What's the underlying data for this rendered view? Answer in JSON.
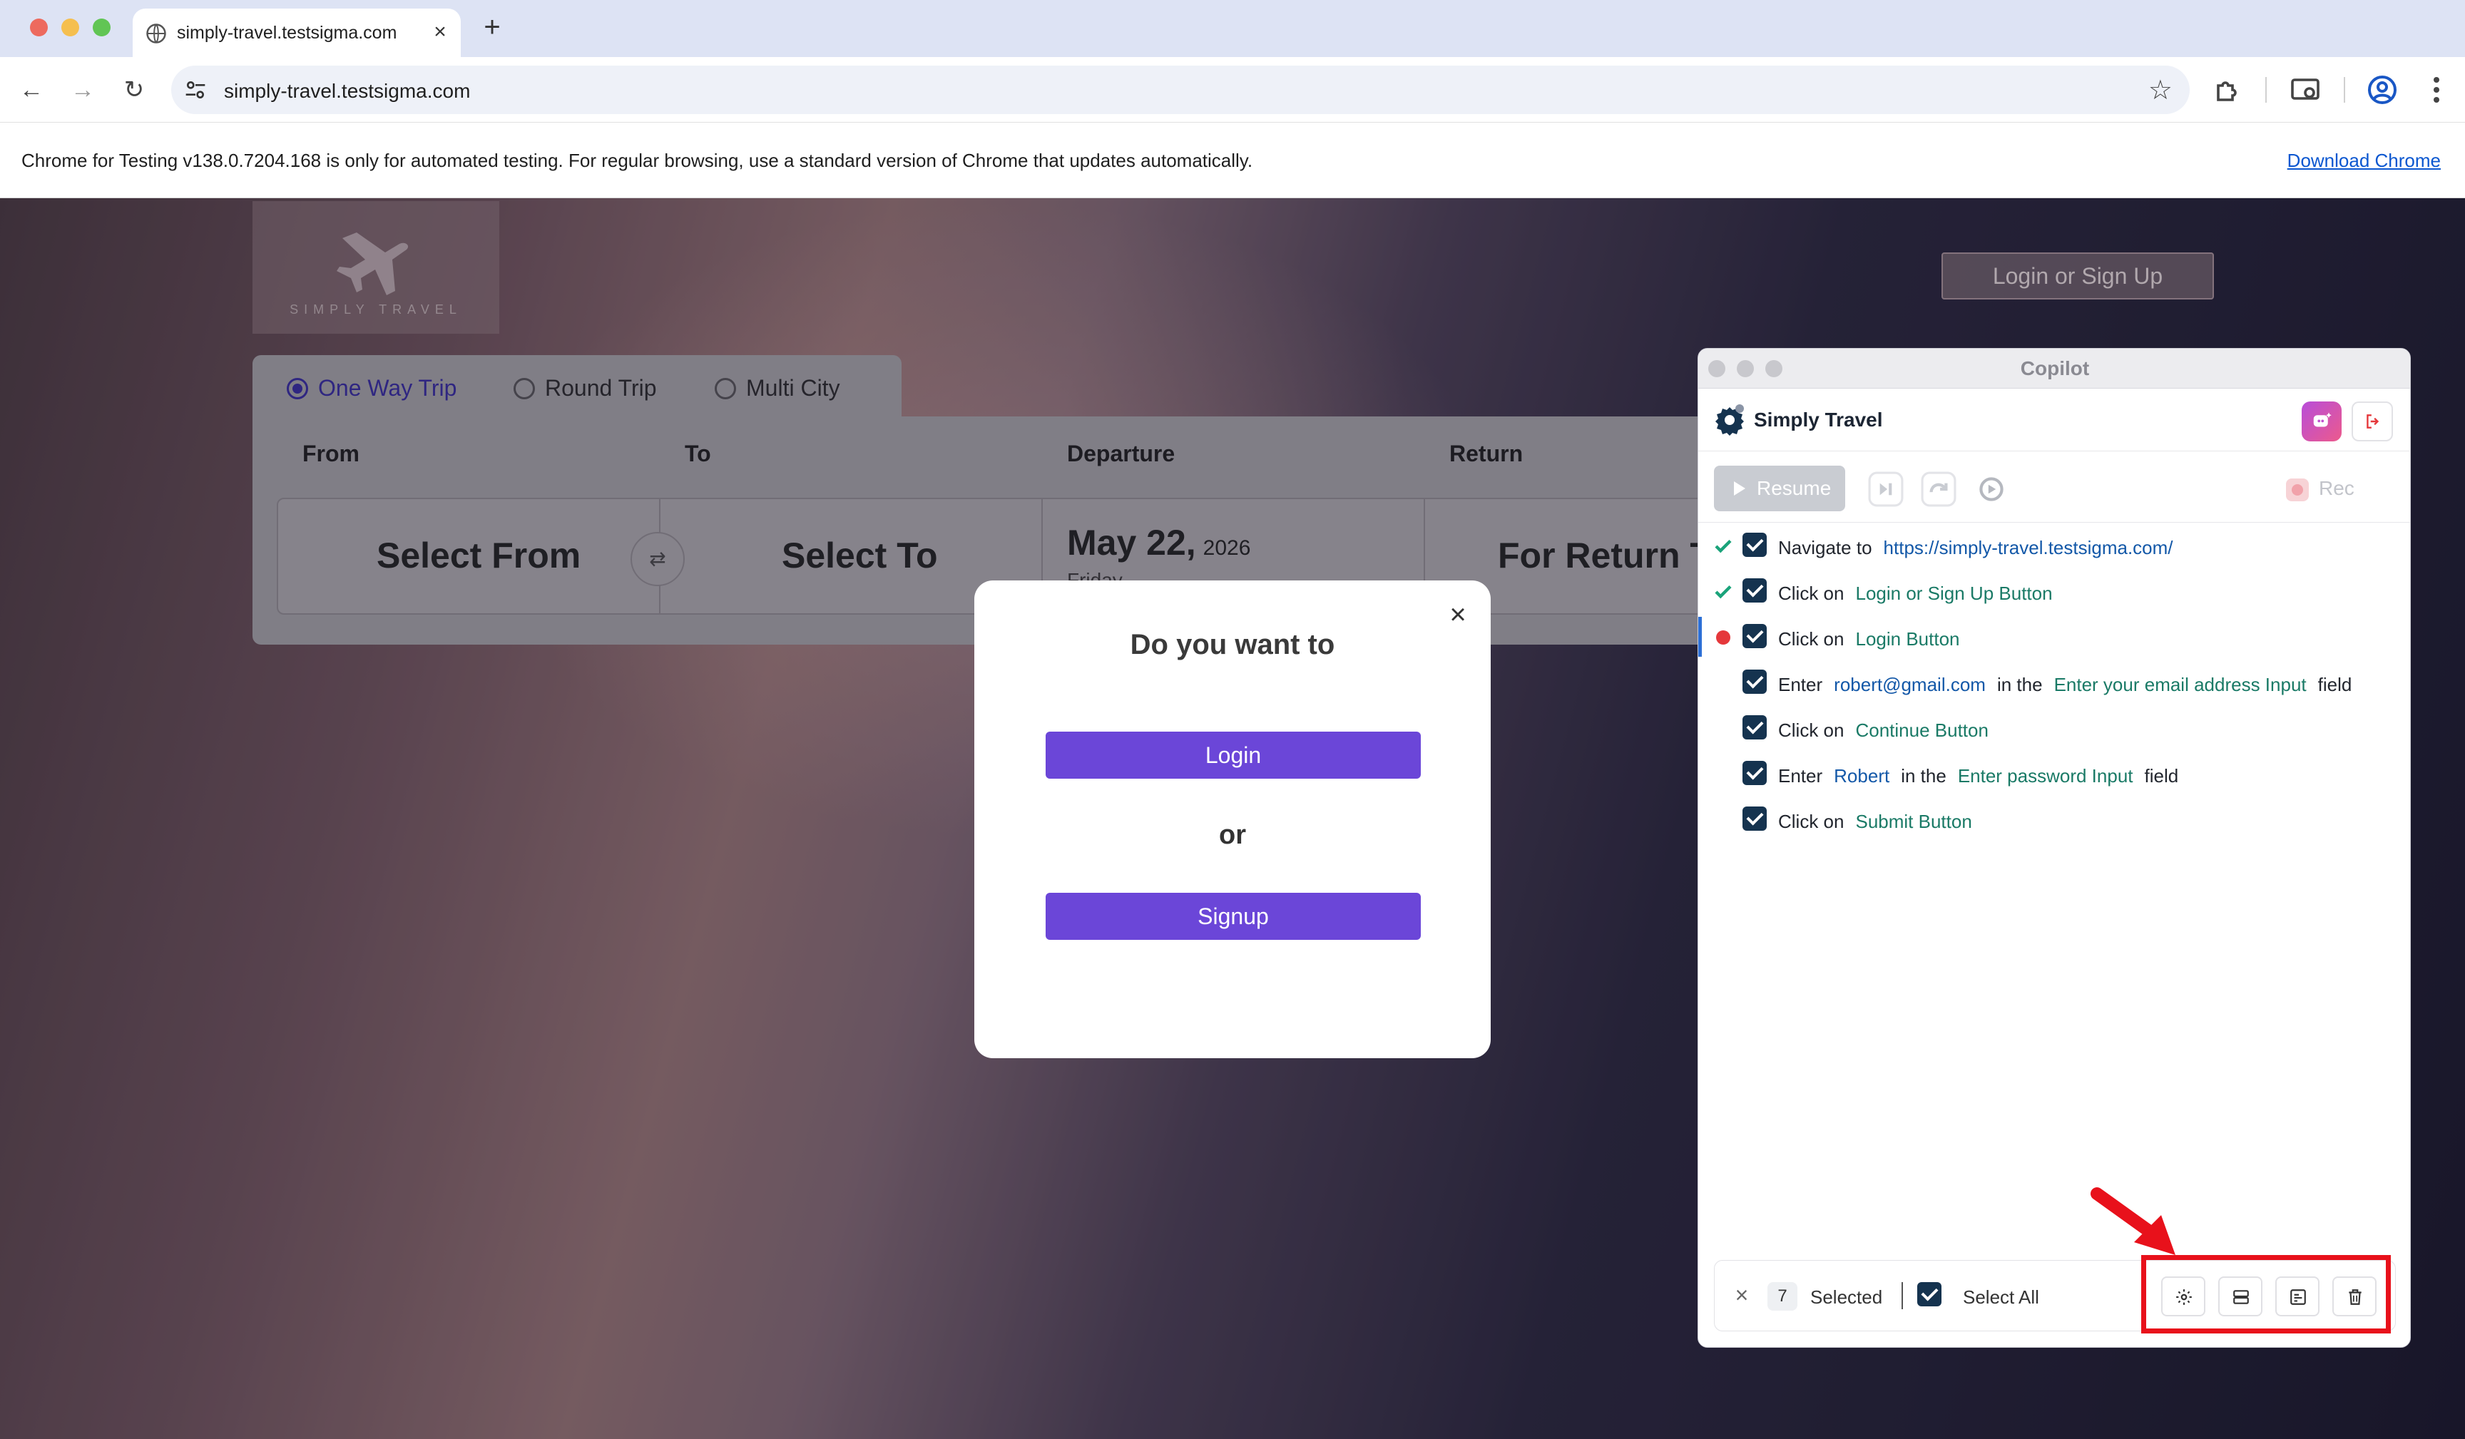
{
  "browser": {
    "tab_title": "simply-travel.testsigma.com",
    "new_tab_symbol": "+",
    "close_tab_symbol": "×",
    "url": "simply-travel.testsigma.com",
    "infobar_text": "Chrome for Testing v138.0.7204.168 is only for automated testing. For regular browsing, use a standard version of Chrome that updates automatically.",
    "infobar_link": "Download Chrome",
    "icons": [
      "back-icon",
      "forward-icon",
      "reload-icon",
      "site-settings-icon",
      "bookmark-star-icon",
      "extensions-icon",
      "cast-icon",
      "profile-icon",
      "menu-icon"
    ]
  },
  "site": {
    "brand_name": "SIMPLY TRAVEL",
    "login_signup_button": "Login or Sign Up",
    "trip_types": [
      {
        "label": "One Way Trip",
        "selected": true
      },
      {
        "label": "Round Trip",
        "selected": false
      },
      {
        "label": "Multi City",
        "selected": false
      }
    ],
    "fields": {
      "from_label": "From",
      "to_label": "To",
      "departure_label": "Departure",
      "return_label": "Return",
      "from_value": "Select From",
      "to_value": "Select To",
      "departure_date": "May 22,",
      "departure_year": "2026",
      "departure_day": "Friday",
      "return_value": "For Return Tr"
    }
  },
  "modal": {
    "title": "Do you want to",
    "login_button": "Login",
    "or_text": "or",
    "signup_button": "Signup",
    "close_symbol": "×"
  },
  "copilot": {
    "window_title": "Copilot",
    "app_name": "Simply Travel",
    "resume_button": "Resume",
    "rec_label": "Rec",
    "steps": [
      {
        "status": "passed",
        "parts": [
          {
            "t": "Navigate to",
            "k": "txt"
          },
          {
            "t": "https://simply-travel.testsigma.com/",
            "k": "val"
          }
        ]
      },
      {
        "status": "passed",
        "parts": [
          {
            "t": "Click on",
            "k": "txt"
          },
          {
            "t": "Login or Sign Up Button",
            "k": "el"
          }
        ]
      },
      {
        "status": "failed",
        "parts": [
          {
            "t": "Click on",
            "k": "txt"
          },
          {
            "t": "Login Button",
            "k": "el"
          }
        ]
      },
      {
        "status": "none",
        "parts": [
          {
            "t": "Enter",
            "k": "txt"
          },
          {
            "t": "robert@gmail.com",
            "k": "val"
          },
          {
            "t": "in the",
            "k": "txt"
          },
          {
            "t": "Enter your email address Input",
            "k": "el"
          },
          {
            "t": "field",
            "k": "txt"
          }
        ]
      },
      {
        "status": "none",
        "parts": [
          {
            "t": "Click on",
            "k": "txt"
          },
          {
            "t": "Continue Button",
            "k": "el"
          }
        ]
      },
      {
        "status": "none",
        "parts": [
          {
            "t": "Enter",
            "k": "txt"
          },
          {
            "t": "Robert",
            "k": "val"
          },
          {
            "t": "in the",
            "k": "txt"
          },
          {
            "t": "Enter password Input",
            "k": "el"
          },
          {
            "t": "field",
            "k": "txt"
          }
        ]
      },
      {
        "status": "none",
        "parts": [
          {
            "t": "Click on",
            "k": "txt"
          },
          {
            "t": "Submit Button",
            "k": "el"
          }
        ]
      }
    ],
    "footer": {
      "selected_count": "7",
      "selected_label": "Selected",
      "select_all_label": "Select All",
      "close_symbol": "×",
      "actions": [
        "settings-icon",
        "group-icon",
        "reusable-step-icon",
        "delete-icon"
      ]
    }
  },
  "colors": {
    "accent_purple": "#6b46d8",
    "pass_green": "#1aa37a",
    "fail_red": "#e5383b",
    "highlight_red": "#e8111b"
  }
}
